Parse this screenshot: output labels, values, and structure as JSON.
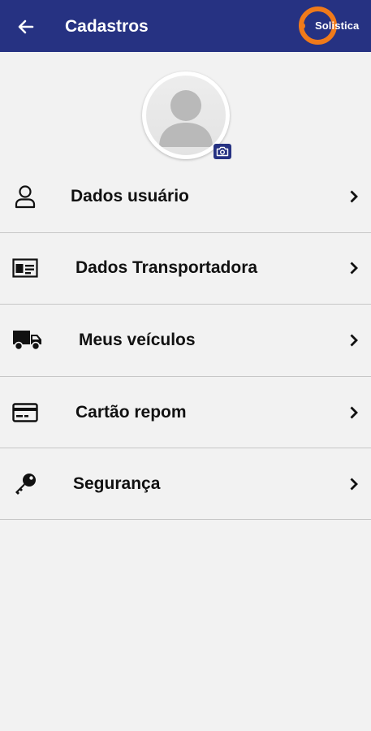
{
  "header": {
    "title": "Cadastros",
    "back_icon": "arrow-left-icon",
    "brand_name": "Solistica",
    "background_color": "#263282",
    "brand_color": "#f07a1a"
  },
  "profile": {
    "avatar_icon": "default-user-avatar",
    "camera_icon": "camera-icon"
  },
  "menu": {
    "items": [
      {
        "label": "Dados usuário",
        "icon": "user-outline-icon"
      },
      {
        "label": "Dados Transportadora",
        "icon": "id-card-icon"
      },
      {
        "label": "Meus veículos",
        "icon": "truck-icon"
      },
      {
        "label": "Cartão repom",
        "icon": "credit-card-icon"
      },
      {
        "label": "Segurança",
        "icon": "key-icon"
      }
    ],
    "chevron_icon": "chevron-right-icon"
  }
}
